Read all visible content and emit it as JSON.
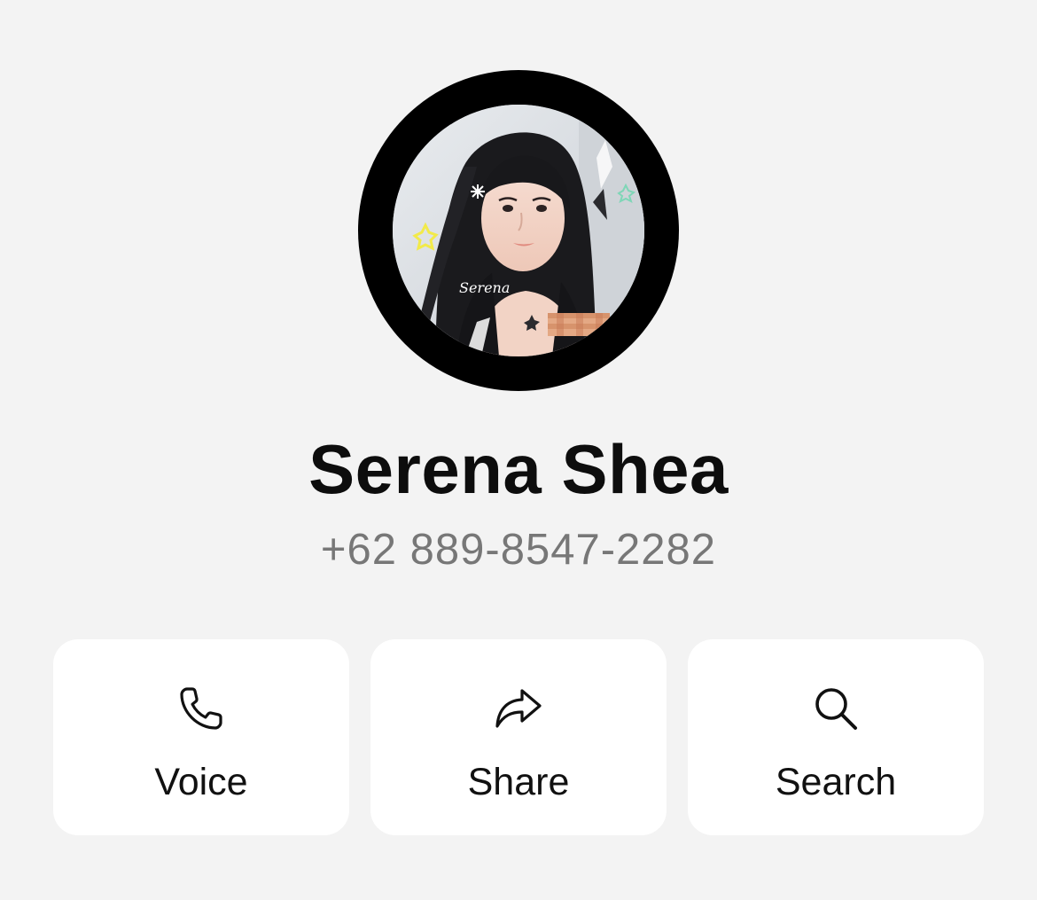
{
  "contact": {
    "name": "Serena Shea",
    "phone": "+62 889-8547-2282",
    "avatar_caption": "Serena"
  },
  "actions": [
    {
      "label": "Voice",
      "icon": "phone-icon"
    },
    {
      "label": "Share",
      "icon": "share-arrow-icon"
    },
    {
      "label": "Search",
      "icon": "search-icon"
    }
  ],
  "colors": {
    "background": "#f3f3f3",
    "card": "#ffffff",
    "avatar_ring": "#000000",
    "name_text": "#0d0d0d",
    "phone_text": "#777777"
  }
}
